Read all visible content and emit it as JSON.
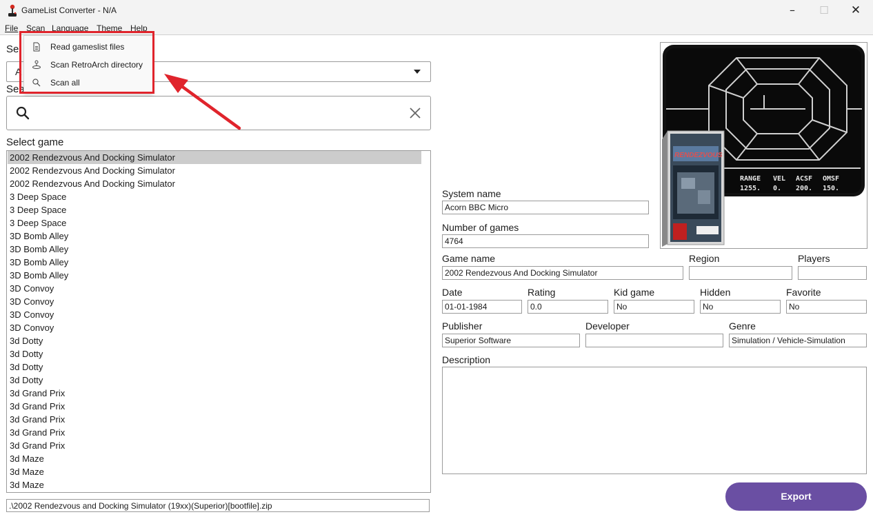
{
  "window": {
    "title": "GameList Converter - N/A"
  },
  "menubar": {
    "file": "File",
    "scan": "Scan",
    "language": "Language",
    "theme": "Theme",
    "help": "Help"
  },
  "scan_menu": {
    "read_gamelist": "Read gameslist files",
    "scan_retroarch": "Scan RetroArch directory",
    "scan_all": "Scan all"
  },
  "left": {
    "system_label": "Sel",
    "system_value": "A",
    "search_label": "Sea",
    "select_game_label": "Select game",
    "games": [
      "2002 Rendezvous And Docking Simulator",
      "2002 Rendezvous And Docking Simulator",
      "2002 Rendezvous And Docking Simulator",
      "3 Deep Space",
      "3 Deep Space",
      "3 Deep Space",
      "3D Bomb Alley",
      "3D Bomb Alley",
      "3D Bomb Alley",
      "3D Bomb Alley",
      "3D Convoy",
      "3D Convoy",
      "3D Convoy",
      "3D Convoy",
      "3d Dotty",
      "3d Dotty",
      "3d Dotty",
      "3d Dotty",
      "3d Grand Prix",
      "3d Grand Prix",
      "3d Grand Prix",
      "3d Grand Prix",
      "3d Grand Prix",
      "3d Maze",
      "3d Maze",
      "3d Maze"
    ],
    "path": ".\\2002 Rendezvous and Docking Simulator (19xx)(Superior)[bootfile].zip"
  },
  "details": {
    "system_name_label": "System name",
    "system_name": "Acorn BBC Micro",
    "num_games_label": "Number of games",
    "num_games": "4764",
    "game_name_label": "Game name",
    "game_name": "2002 Rendezvous And Docking Simulator",
    "region_label": "Region",
    "region": "",
    "players_label": "Players",
    "players": "",
    "date_label": "Date",
    "date": "01-01-1984",
    "rating_label": "Rating",
    "rating": "0.0",
    "kid_label": "Kid game",
    "kid": "No",
    "hidden_label": "Hidden",
    "hidden": "No",
    "favorite_label": "Favorite",
    "favorite": "No",
    "publisher_label": "Publisher",
    "publisher": "Superior Software",
    "developer_label": "Developer",
    "developer": "",
    "genre_label": "Genre",
    "genre": "Simulation / Vehicle-Simulation",
    "description_label": "Description"
  },
  "screen": {
    "hud_headers": [
      "RANGE",
      "VEL",
      "ACSF",
      "OMSF"
    ],
    "hud_values": [
      "1255.",
      "0.",
      "200.",
      "150."
    ],
    "box_title": "RENDEZVOUS"
  },
  "export_label": "Export",
  "colors": {
    "accent": "#6a4fa3",
    "annotation": "#e0242c",
    "selected_row": "#cccccc"
  }
}
